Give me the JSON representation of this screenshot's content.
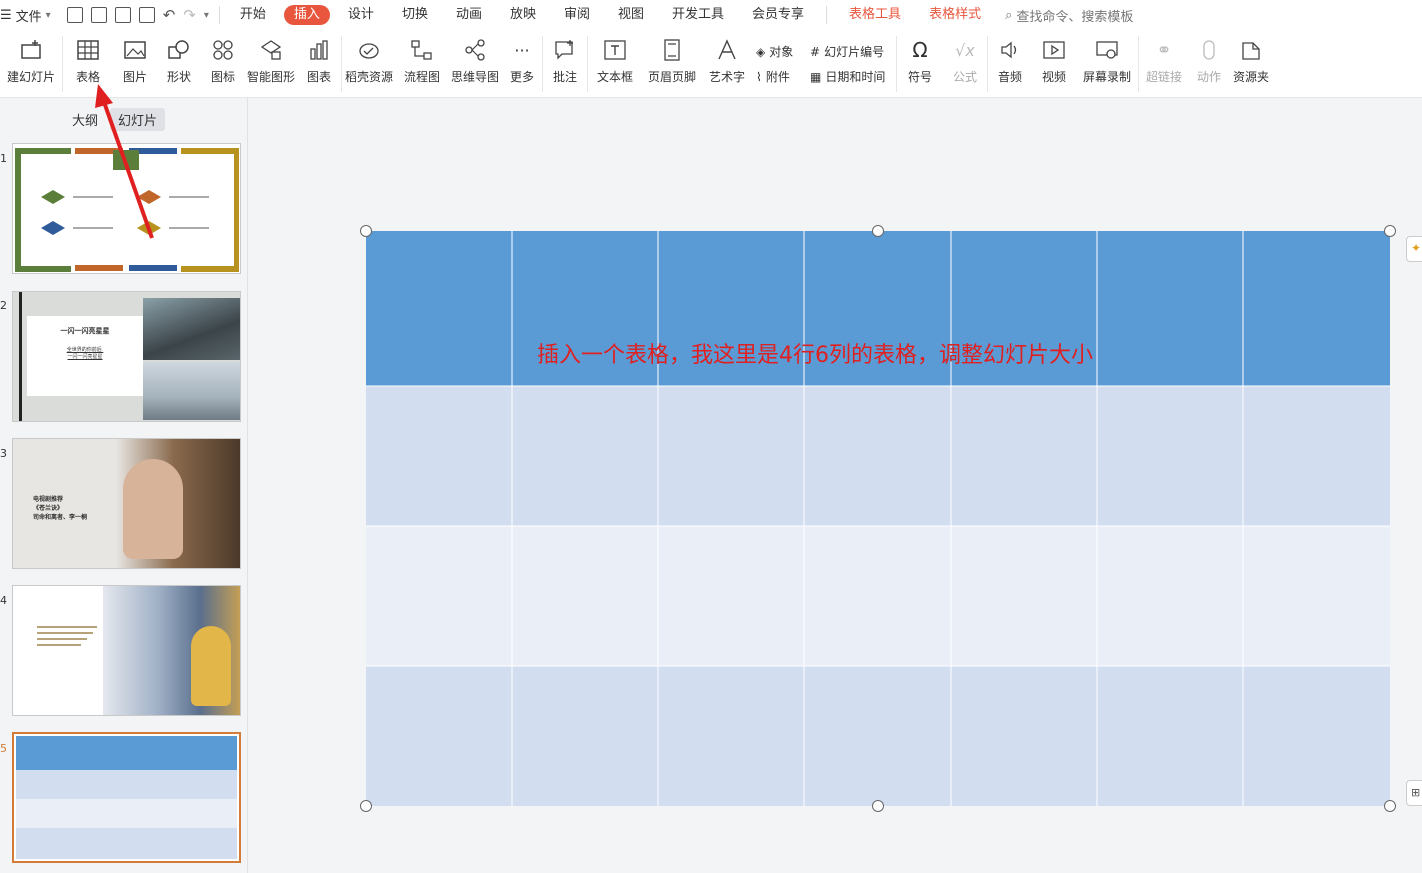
{
  "menubar": {
    "file_label": "文件",
    "tabs": [
      {
        "label": "开始"
      },
      {
        "label": "插入",
        "active": true
      },
      {
        "label": "设计"
      },
      {
        "label": "切换"
      },
      {
        "label": "动画"
      },
      {
        "label": "放映"
      },
      {
        "label": "审阅"
      },
      {
        "label": "视图"
      },
      {
        "label": "开发工具"
      },
      {
        "label": "会员专享"
      }
    ],
    "context_tabs": [
      "表格工具",
      "表格样式"
    ],
    "search_placeholder": "查找命令、搜索模板"
  },
  "ribbon": {
    "new_slide": "建幻灯片",
    "table": "表格",
    "picture": "图片",
    "shape": "形状",
    "icon": "图标",
    "smartart": "智能图形",
    "chart": "图表",
    "docer": "稻壳资源",
    "flowchart": "流程图",
    "mindmap": "思维导图",
    "more": "更多",
    "comment": "批注",
    "textbox": "文本框",
    "header_footer": "页眉页脚",
    "wordart": "艺术字",
    "object": "对象",
    "attachment": "附件",
    "slide_number": "幻灯片编号",
    "datetime": "日期和时间",
    "symbol": "符号",
    "formula": "公式",
    "audio": "音频",
    "video": "视频",
    "screen_record": "屏幕录制",
    "hyperlink": "超链接",
    "action": "动作",
    "resources": "资源夹"
  },
  "leftpanel": {
    "tab_outline": "大纲",
    "tab_slides": "幻灯片",
    "slides": [
      {
        "num": "1"
      },
      {
        "num": "2",
        "title": "一闪一闪亮星星",
        "text": "全世界的你前后 \n一闪一闪亮星星"
      },
      {
        "num": "3",
        "title": "电视剧推荐",
        "sub1": "《苍兰诀》",
        "sub2": "司命和离者、李一桐"
      },
      {
        "num": "4"
      },
      {
        "num": "5"
      }
    ]
  },
  "annotation": "插入一个表格，我这里是4行6列的表格，调整幻灯片大小",
  "colors": {
    "accent": "#e8563e",
    "header_row": "#5b9bd5",
    "row_dark": "#d2deef",
    "row_light": "#eaeff7",
    "arrow": "#e02020"
  }
}
